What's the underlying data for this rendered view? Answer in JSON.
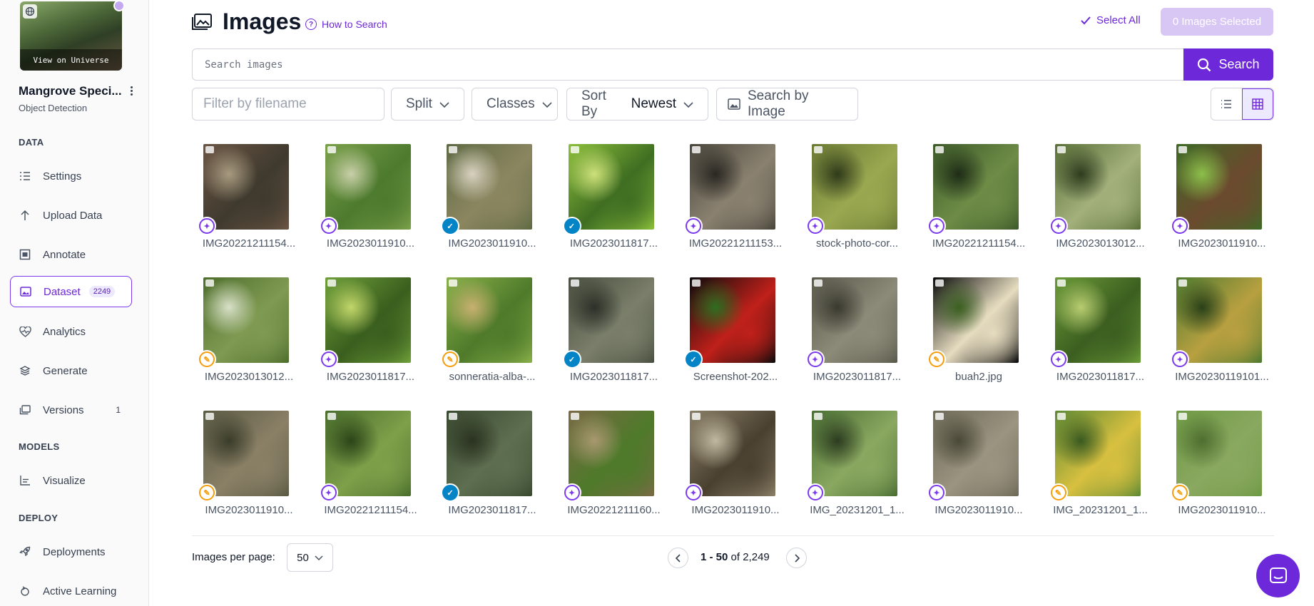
{
  "sidebar": {
    "view_on_universe": "View on Universe",
    "project_name": "Mangrove Speci...",
    "project_type": "Object Detection",
    "sections": {
      "data": "DATA",
      "models": "MODELS",
      "deploy": "DEPLOY"
    },
    "items": [
      {
        "label": "Settings",
        "icon": "list-settings-icon"
      },
      {
        "label": "Upload Data",
        "icon": "arrow-up-icon"
      },
      {
        "label": "Annotate",
        "icon": "annotate-icon"
      },
      {
        "label": "Dataset",
        "icon": "image-icon",
        "badge": "2249",
        "active": true
      },
      {
        "label": "Analytics",
        "icon": "heart-analytics-icon"
      },
      {
        "label": "Generate",
        "icon": "layers-icon"
      },
      {
        "label": "Versions",
        "icon": "versions-icon",
        "count": "1"
      },
      {
        "label": "Visualize",
        "icon": "chart-icon"
      },
      {
        "label": "Deployments",
        "icon": "rocket-icon"
      },
      {
        "label": "Active Learning",
        "icon": "loop-icon"
      }
    ]
  },
  "header": {
    "title": "Images",
    "how_to": "How to Search",
    "select_all": "Select All",
    "selected_button": "0 Images Selected"
  },
  "search": {
    "placeholder": "Search images",
    "button": "Search"
  },
  "filters": {
    "filename_placeholder": "Filter by filename",
    "split": "Split",
    "classes": "Classes",
    "sort_label": "Sort By",
    "sort_value": "Newest",
    "search_by_image": "Search by Image"
  },
  "images": [
    {
      "name": "IMG20221211154...",
      "status": "annotated",
      "palette": [
        "#6b5544",
        "#3f3a2e",
        "#a89a80"
      ]
    },
    {
      "name": "IMG2023011910...",
      "status": "annotated",
      "palette": [
        "#7aa04a",
        "#4d7a2e",
        "#c8cfa8"
      ]
    },
    {
      "name": "IMG2023011910...",
      "status": "reviewed",
      "palette": [
        "#5e6a44",
        "#8b8660",
        "#d8d2c0"
      ]
    },
    {
      "name": "IMG2023011817...",
      "status": "reviewed",
      "palette": [
        "#8cbf3c",
        "#3f6e22",
        "#cde07a"
      ]
    },
    {
      "name": "IMG20221211153...",
      "status": "annotated",
      "palette": [
        "#4a463c",
        "#8a8170",
        "#2a2822"
      ]
    },
    {
      "name": "stock-photo-cor...",
      "status": "annotated",
      "palette": [
        "#6a7a34",
        "#9aa850",
        "#2f3a1a"
      ]
    },
    {
      "name": "IMG20221211154...",
      "status": "annotated",
      "palette": [
        "#3d5a2a",
        "#6e8c46",
        "#1e2c16"
      ]
    },
    {
      "name": "IMG2023013012...",
      "status": "annotated",
      "palette": [
        "#5a7038",
        "#a3b07c",
        "#2e3c1e"
      ]
    },
    {
      "name": "IMG2023011910...",
      "status": "annotated",
      "palette": [
        "#3e6a26",
        "#6b4a2e",
        "#8cbf4a"
      ]
    },
    {
      "name": "IMG2023013012...",
      "status": "unannotated",
      "palette": [
        "#4e6e2c",
        "#7f9a52",
        "#d8e0c8"
      ]
    },
    {
      "name": "IMG2023011817...",
      "status": "annotated",
      "palette": [
        "#6fa03a",
        "#3a5e1e",
        "#c2d66a"
      ]
    },
    {
      "name": "sonneratia-alba-...",
      "status": "unannotated",
      "palette": [
        "#8ab04a",
        "#4e7a2a",
        "#c8b070"
      ]
    },
    {
      "name": "IMG2023011817...",
      "status": "reviewed",
      "palette": [
        "#4a5040",
        "#7a7e6a",
        "#2c3028"
      ]
    },
    {
      "name": "Screenshot-202...",
      "status": "reviewed",
      "palette": [
        "#0c0c0c",
        "#c0201a",
        "#2f6e20"
      ]
    },
    {
      "name": "IMG2023011817...",
      "status": "annotated",
      "palette": [
        "#5a5a4c",
        "#8c8a78",
        "#3a3a30"
      ]
    },
    {
      "name": "buah2.jpg",
      "status": "unannotated",
      "palette": [
        "#0a0a0a",
        "#e6dcc0",
        "#3a6020"
      ]
    },
    {
      "name": "IMG2023011817...",
      "status": "annotated",
      "palette": [
        "#6a9a38",
        "#3c5e20",
        "#b8cc70"
      ]
    },
    {
      "name": "IMG20230119101...",
      "status": "annotated",
      "palette": [
        "#4e7a30",
        "#b8a040",
        "#2a4018"
      ]
    },
    {
      "name": "IMG2023011910...",
      "status": "unannotated",
      "palette": [
        "#5a5a44",
        "#8a8066",
        "#3a3c2a"
      ]
    },
    {
      "name": "IMG20221211154...",
      "status": "annotated",
      "palette": [
        "#4a6e2c",
        "#7ea04a",
        "#2c4418"
      ]
    },
    {
      "name": "IMG2023011817...",
      "status": "reviewed",
      "palette": [
        "#3a4a30",
        "#5e6e50",
        "#2a3220"
      ]
    },
    {
      "name": "IMG20221211160...",
      "status": "annotated",
      "palette": [
        "#7a6a46",
        "#4e7a2a",
        "#a89870"
      ]
    },
    {
      "name": "IMG2023011910...",
      "status": "annotated",
      "palette": [
        "#8a8068",
        "#4a4030",
        "#c0b8a0"
      ]
    },
    {
      "name": "IMG_20231201_1...",
      "status": "annotated",
      "palette": [
        "#4a6e34",
        "#8aa860",
        "#2c3c20"
      ]
    },
    {
      "name": "IMG2023011910...",
      "status": "annotated",
      "palette": [
        "#6e6a58",
        "#9a9480",
        "#4a4838"
      ]
    },
    {
      "name": "IMG_20231201_1...",
      "status": "unannotated",
      "palette": [
        "#5e8a34",
        "#d8c040",
        "#3a5a20"
      ]
    },
    {
      "name": "IMG2023011910...",
      "status": "unannotated",
      "palette": [
        "#6e9a44",
        "#8aa860",
        "#4e6e30"
      ]
    }
  ],
  "pagination": {
    "per_page_label": "Images per page:",
    "per_page_value": "50",
    "range": "1 - 50",
    "of_label": "of",
    "total": "2,249"
  },
  "colors": {
    "accent": "#6d28d9",
    "annotated_badge": "#7c3aed",
    "reviewed_badge": "#0284c7",
    "unannotated_badge": "#f59e0b"
  }
}
